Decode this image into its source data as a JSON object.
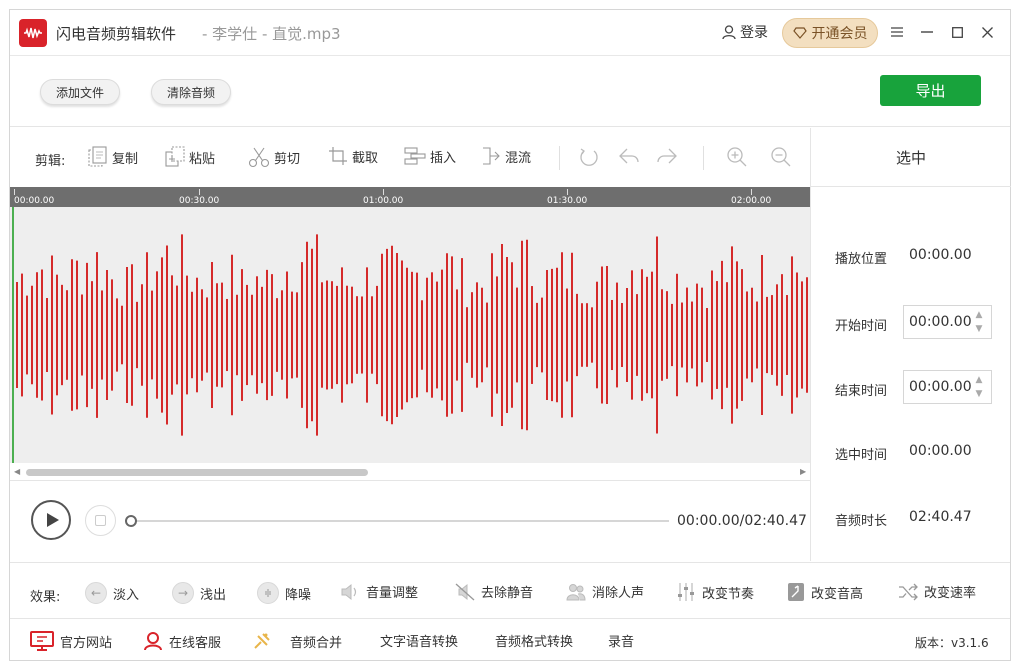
{
  "titlebar": {
    "app_name": "闪电音频剪辑软件",
    "file_name": "- 李学仕 - 直觉.mp3",
    "login_label": "登录",
    "vip_label": "开通会员"
  },
  "file_toolbar": {
    "add_file_label": "添加文件",
    "clear_audio_label": "清除音频",
    "export_label": "导出"
  },
  "edit_toolbar": {
    "section_label": "剪辑:",
    "tools": {
      "copy": "复制",
      "paste": "粘贴",
      "cut": "剪切",
      "crop": "截取",
      "insert": "插入",
      "mix": "混流"
    }
  },
  "timeline": {
    "ticks": [
      "00:00.00",
      "00:30.00",
      "01:00.00",
      "01:30.00",
      "02:00.00"
    ]
  },
  "player": {
    "time_readout": "00:00.00/02:40.47",
    "progress_fraction": 0
  },
  "selection_panel": {
    "title": "选中",
    "play_position_label": "播放位置",
    "play_position_value": "00:00.00",
    "start_time_label": "开始时间",
    "start_time_value": "00:00.00",
    "end_time_label": "结束时间",
    "end_time_value": "00:00.00",
    "selected_time_label": "选中时间",
    "selected_time_value": "00:00.00",
    "duration_label": "音频时长",
    "duration_value": "02:40.47"
  },
  "effects": {
    "section_label": "效果:",
    "fade_in": "淡入",
    "fade_out": "浅出",
    "denoise": "降噪",
    "volume": "音量调整",
    "remove_silence": "去除静音",
    "remove_vocals": "消除人声",
    "change_tempo": "改变节奏",
    "change_pitch": "改变音高",
    "change_speed": "改变速率"
  },
  "footer": {
    "website": "官方网站",
    "support": "在线客服",
    "merge": "音频合并",
    "tts": "文字语音转换",
    "convert": "音频格式转换",
    "record": "录音",
    "version": "版本：v3.1.6"
  },
  "colors": {
    "brand_red": "#d9232a",
    "waveform": "#d52a2a",
    "export_green": "#18a33c",
    "vip_gold": "#f3dfc0"
  }
}
